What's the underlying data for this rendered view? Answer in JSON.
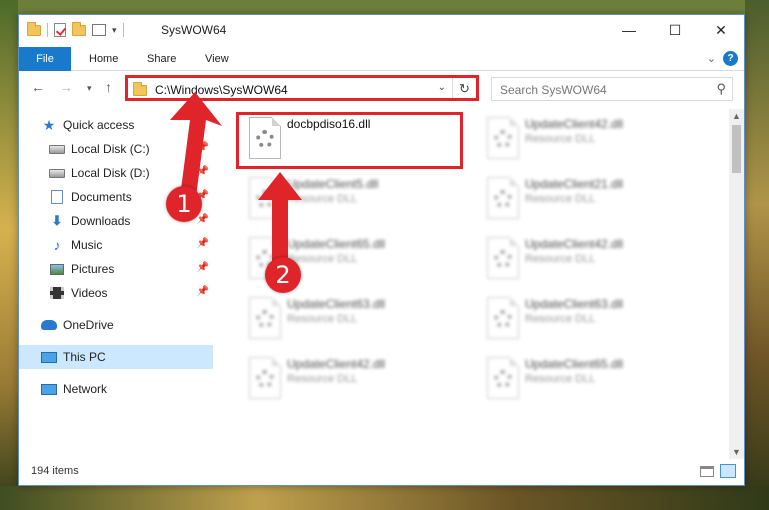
{
  "window": {
    "title": "SysWOW64",
    "minimize": "—",
    "maximize": "☐",
    "close": "✕"
  },
  "ribbon": {
    "tabs": [
      "File",
      "Home",
      "Share",
      "View"
    ],
    "help": "?"
  },
  "address_bar": {
    "path": "C:\\Windows\\SysWOW64",
    "search_placeholder": "Search SysWOW64"
  },
  "nav_pane": {
    "items": [
      {
        "label": "Quick access",
        "icon": "star-icon"
      },
      {
        "label": "Local Disk (C:)",
        "icon": "disk-icon",
        "pinned": true
      },
      {
        "label": "Local Disk (D:)",
        "icon": "disk-icon",
        "pinned": true
      },
      {
        "label": "Documents",
        "icon": "documents-icon",
        "pinned": true
      },
      {
        "label": "Downloads",
        "icon": "downloads-icon",
        "pinned": true
      },
      {
        "label": "Music",
        "icon": "music-icon",
        "pinned": true
      },
      {
        "label": "Pictures",
        "icon": "pictures-icon",
        "pinned": true
      },
      {
        "label": "Videos",
        "icon": "videos-icon",
        "pinned": true
      },
      {
        "label": "OneDrive",
        "icon": "onedrive-icon"
      },
      {
        "label": "This PC",
        "icon": "pc-icon",
        "selected": true
      },
      {
        "label": "Network",
        "icon": "network-icon"
      }
    ]
  },
  "files": [
    {
      "name": "docbpdiso16.dll",
      "type": ""
    },
    {
      "name": "UpdateClient42.dll",
      "type": "Resource DLL"
    },
    {
      "name": "UpdateClient5.dll",
      "type": "Resource DLL"
    },
    {
      "name": "UpdateClient21.dll",
      "type": "Resource DLL"
    },
    {
      "name": "UpdateClient65.dll",
      "type": "Resource DLL"
    },
    {
      "name": "UpdateClient42.dll",
      "type": "Resource DLL"
    },
    {
      "name": "UpdateClient63.dll",
      "type": "Resource DLL"
    },
    {
      "name": "UpdateClient63.dll",
      "type": "Resource DLL"
    },
    {
      "name": "UpdateClient42.dll",
      "type": "Resource DLL"
    },
    {
      "name": "UpdateClient65.dll",
      "type": "Resource DLL"
    }
  ],
  "status": {
    "item_count": "194 items"
  },
  "annotations": {
    "step1": "1",
    "step2": "2",
    "color": "#e0252a"
  },
  "colors": {
    "accent": "#1979ca",
    "selection": "#cce8ff"
  }
}
